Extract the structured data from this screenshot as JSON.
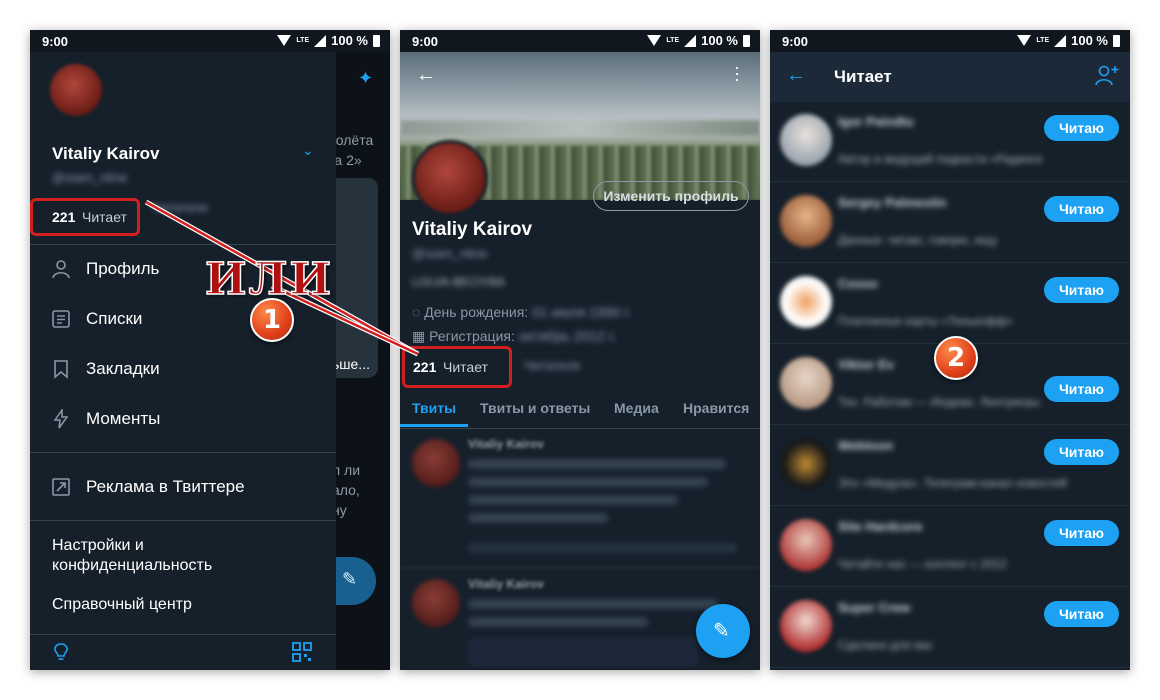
{
  "status_bar": {
    "time": "9:00",
    "network": "LTE",
    "battery": "100 %"
  },
  "panel1": {
    "profile_name": "Vitaliy Kairov",
    "handle": "@siam_nline",
    "following_count": "221",
    "following_label": "Читает",
    "followers_label": "Читателя",
    "menu": [
      {
        "label": "Профиль",
        "icon": "person-icon"
      },
      {
        "label": "Списки",
        "icon": "list-icon"
      },
      {
        "label": "Закладки",
        "icon": "bookmark-icon"
      },
      {
        "label": "Моменты",
        "icon": "lightning-icon"
      }
    ],
    "ads_label": "Реклама в Твиттере",
    "settings_line1": "Настройки и",
    "settings_line2": "конфиденциальность",
    "help_label": "Справочный центр",
    "behind_texts": [
      "ролёта",
      "ка 2»",
      "ьше...",
      "л ли",
      "ало,",
      "ну"
    ]
  },
  "panel2": {
    "edit_profile": "Изменить профиль",
    "name": "Vitaliy Kairov",
    "handle": "@siam_nline",
    "bio": "LOLVA-BECIYBA",
    "birthday_label": "День рождения:",
    "birthday_value": "01 июля 1990 г.",
    "joined_label": "Регистрация:",
    "joined_value": "октябрь 2012 г.",
    "following_count": "221",
    "following_label": "Читает",
    "followers_label": "Читателя",
    "tabs": [
      "Твиты",
      "Твиты и ответы",
      "Медиа",
      "Нравится"
    ],
    "tweet_author": "Vitaliy Kairov"
  },
  "panel3": {
    "title": "Читает",
    "follow_label": "Читаю",
    "users": [
      {
        "name": "Igor Paindtu",
        "text": "Автор и ведущий подкаста «Радиоги"
      },
      {
        "name": "Sergey Palmestin",
        "text": "Данные: читаю, говорю, ищу"
      },
      {
        "name": "Cosso",
        "text": "Платежные карты «Тинькофф»"
      },
      {
        "name": "Viktor Ev",
        "text": "Тех. Работаю — Индиан. Лентригры"
      },
      {
        "name": "Webtoon",
        "text": "Это «Медуза». Телеграм-канал новостей"
      },
      {
        "name": "Site Hardcore",
        "text": "Читайте нас — контент с 2012"
      },
      {
        "name": "Super Crew",
        "text": "Сделано для вас"
      }
    ]
  },
  "annotations": {
    "or_text": "ИЛИ",
    "step1": "1",
    "step2": "2"
  },
  "colors": {
    "background": "#15202b",
    "accent": "#1da1f2",
    "highlight": "#d21f1f"
  }
}
